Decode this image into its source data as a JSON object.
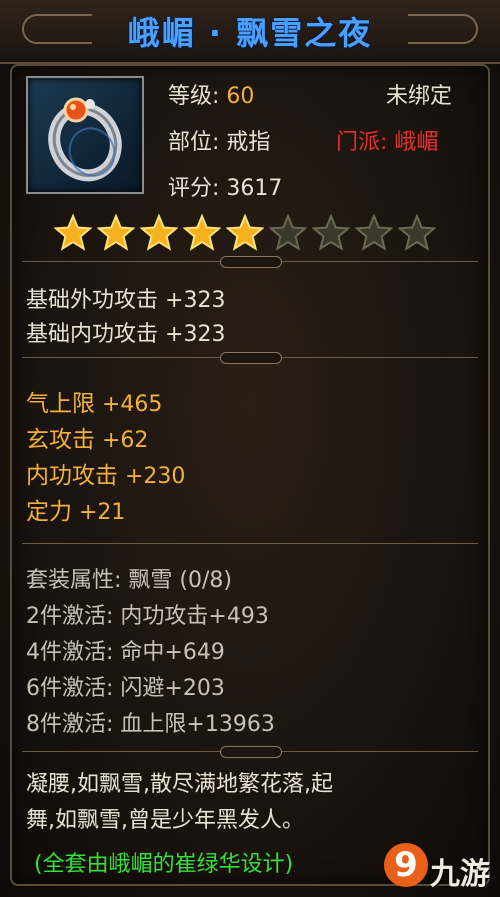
{
  "item": {
    "title": "峨嵋 · 飘雪之夜",
    "level_label": "等级:",
    "level_value": "60",
    "bind_status": "未绑定",
    "slot_label": "部位:",
    "slot_value": "戒指",
    "school_label": "门派:",
    "school_value": "峨嵋",
    "score_label": "评分:",
    "score_value": "3617",
    "icon": "silver-ring-with-orange-gem-icon"
  },
  "stars": {
    "filled": 5,
    "total": 9
  },
  "base_attrs": [
    {
      "name": "基础外功攻击",
      "value": "+323"
    },
    {
      "name": "基础内功攻击",
      "value": "+323"
    }
  ],
  "extra_attrs": [
    {
      "name": "气上限",
      "value": "+465"
    },
    {
      "name": "玄攻击",
      "value": "+62"
    },
    {
      "name": "内功攻击",
      "value": "+230"
    },
    {
      "name": "定力",
      "value": "+21"
    }
  ],
  "set": {
    "header": "套装属性: 飘雪 (0/8)",
    "bonuses": [
      "2件激活: 内功攻击+493",
      "4件激活: 命中+649",
      "6件激活: 闪避+203",
      "8件激活: 血上限+13963"
    ]
  },
  "description": {
    "line1": "凝腰,如飘雪,散尽满地繁花落,起",
    "line2": "舞,如飘雪,曾是少年黑发人。",
    "designer": "(全套由峨嵋的崔绿华设计)"
  },
  "watermark": {
    "logo_char": "9",
    "text": "九游"
  },
  "colors": {
    "title": "#4aa0ff",
    "gold": "#f2b23a",
    "red": "#e8302a",
    "green": "#33e03c"
  }
}
